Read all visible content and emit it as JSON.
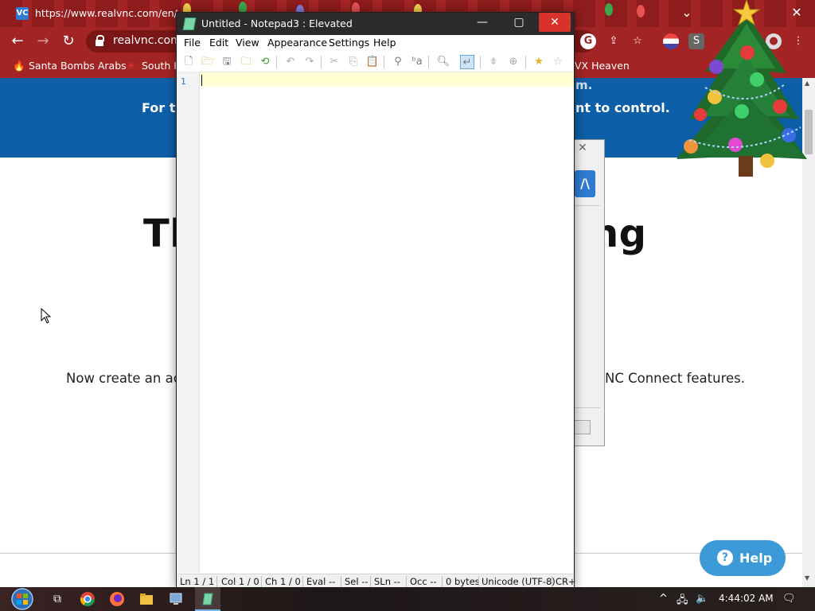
{
  "browser": {
    "tab_url": "https://www.realvnc.com/en/con",
    "tab_favicon": "VC",
    "address": "realvnc.com/",
    "window_controls": {
      "chevron": "⌄",
      "minimize": "—",
      "maximize": "▢",
      "close": "✕"
    },
    "nav": {
      "back": "←",
      "forward": "→",
      "reload": "↻"
    },
    "toolbar_icons": [
      "google-icon",
      "share-icon",
      "star-icon",
      "profile-flag-icon",
      "extension-s-icon",
      "puzzle-icon",
      "avatar-icon",
      "more-icon"
    ],
    "bookmarks": [
      {
        "icon": "fire-icon",
        "glyph": "🔥",
        "label": "Santa Bombs Arabs"
      },
      {
        "icon": "asterisk-icon",
        "glyph": "✳",
        "label": "South H"
      },
      {
        "icon": "",
        "glyph": "",
        "label": "VX Heaven"
      }
    ]
  },
  "page": {
    "banner_top": "m.",
    "banner_left": "For th",
    "banner_right": "nt to control.",
    "headline_left": "Th",
    "headline_right": "ing",
    "body_left": "Now create an acc",
    "body_right": "NC Connect features.",
    "help_button": "Help",
    "help_glyph": "?"
  },
  "vnc_dialog": {
    "close": "✕",
    "logo": "/\\"
  },
  "notepad": {
    "title": "Untitled - Notepad3 : Elevated",
    "window_buttons": {
      "minimize": "—",
      "maximize": "▢",
      "close": "✕"
    },
    "menu": [
      "File",
      "Edit",
      "View",
      "Appearance",
      "Settings",
      "Help"
    ],
    "line_number": "1",
    "status": {
      "ln": "Ln  1 / 1",
      "col": "Col  1 / 0",
      "ch": "Ch  1 / 0",
      "eval": "Eval  --",
      "sel": "Sel  --",
      "sln": "SLn  --",
      "occ": "Occ  --",
      "bytes": "0 bytes",
      "encoding": "Unicode (UTF-8)",
      "eol": "CR+"
    }
  },
  "taskbar": {
    "time": "4:44:02 AM",
    "tray_arrow": "^",
    "icons": [
      "start-orb-icon",
      "task-view-icon",
      "chrome-icon",
      "firefox-icon",
      "explorer-icon",
      "remote-icon",
      "notepad3-icon"
    ]
  },
  "colors": {
    "browser_frame": "#a32424",
    "banner": "#0c5ea6",
    "help_button": "#3d9ad8",
    "current_line": "#ffffd2",
    "notepad_close": "#d9312b"
  }
}
